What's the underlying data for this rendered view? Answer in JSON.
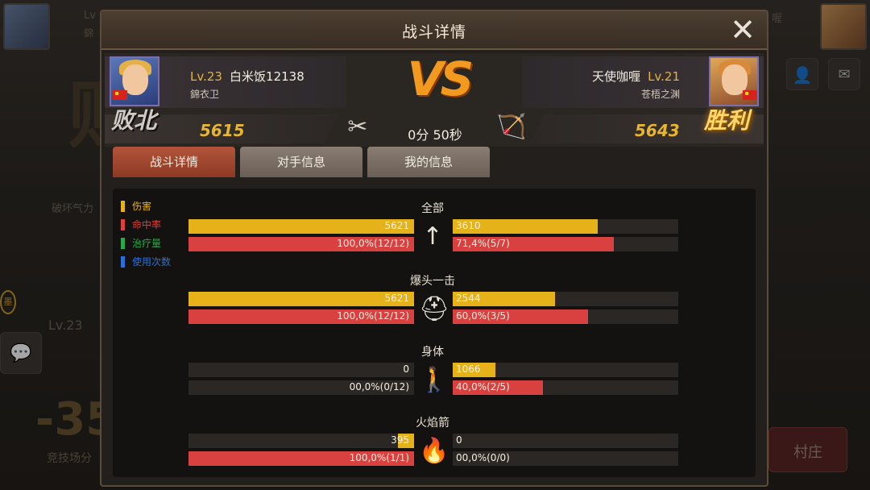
{
  "background": {
    "left_player_lv": "Lv",
    "left_guild_short": "錦",
    "right_name_short": "喔",
    "side_label": "破坏气力",
    "level": "Lv.23",
    "big_number": "-35",
    "arena_label": "竞技场分",
    "village_button": "村庄",
    "badge_char": "墨"
  },
  "dialog": {
    "title": "战斗详情",
    "close_symbol": "✕"
  },
  "left_player": {
    "level": "Lv.23",
    "name": "白米饭12138",
    "guild": "錦衣卫",
    "score": "5615",
    "result": "败北"
  },
  "right_player": {
    "level": "Lv.21",
    "name": "天使咖喱",
    "guild": "苍梧之渊",
    "score": "5643",
    "result": "胜利"
  },
  "versus": {
    "vs_label": "VS",
    "time": "0分 50秒"
  },
  "tabs": [
    {
      "label": "战斗详情",
      "active": true
    },
    {
      "label": "对手信息",
      "active": false
    },
    {
      "label": "我的信息",
      "active": false
    }
  ],
  "legend": [
    {
      "label": "伤害",
      "color": "#e5b21a"
    },
    {
      "label": "命中率",
      "color": "#d8413f"
    },
    {
      "label": "治疗量",
      "color": "#2aa84a"
    },
    {
      "label": "使用次数",
      "color": "#2a6fd6"
    }
  ],
  "colors": {
    "damage": "#e5b21a",
    "hit_rate": "#d8413f",
    "accent_orange": "#f29a1f",
    "score_gold": "#e8b531"
  },
  "chart_data": {
    "type": "bar",
    "categories": [
      "全部",
      "爆头一击",
      "身体",
      "火焰箭"
    ],
    "icons": [
      "arrow-icon",
      "helmet-icon",
      "body-icon",
      "fire-icon"
    ],
    "left": {
      "damage": {
        "values": [
          5621,
          5621,
          0,
          395
        ],
        "labels": [
          "5621",
          "5621",
          "0",
          "395"
        ]
      },
      "hit_rate": {
        "fractions": [
          1.0,
          1.0,
          0.0,
          1.0
        ],
        "labels": [
          "100,0%(12/12)",
          "100,0%(12/12)",
          "00,0%(0/12)",
          "100,0%(1/1)"
        ]
      }
    },
    "right": {
      "damage": {
        "values": [
          3610,
          2544,
          1066,
          0
        ],
        "labels": [
          "3610",
          "2544",
          "1066",
          "0"
        ]
      },
      "hit_rate": {
        "fractions": [
          0.714,
          0.6,
          0.4,
          0.0
        ],
        "labels": [
          "71,4%(5/7)",
          "60,0%(3/5)",
          "40,0%(2/5)",
          "00,0%(0/0)"
        ]
      }
    },
    "damage_scale_max": 5621
  }
}
